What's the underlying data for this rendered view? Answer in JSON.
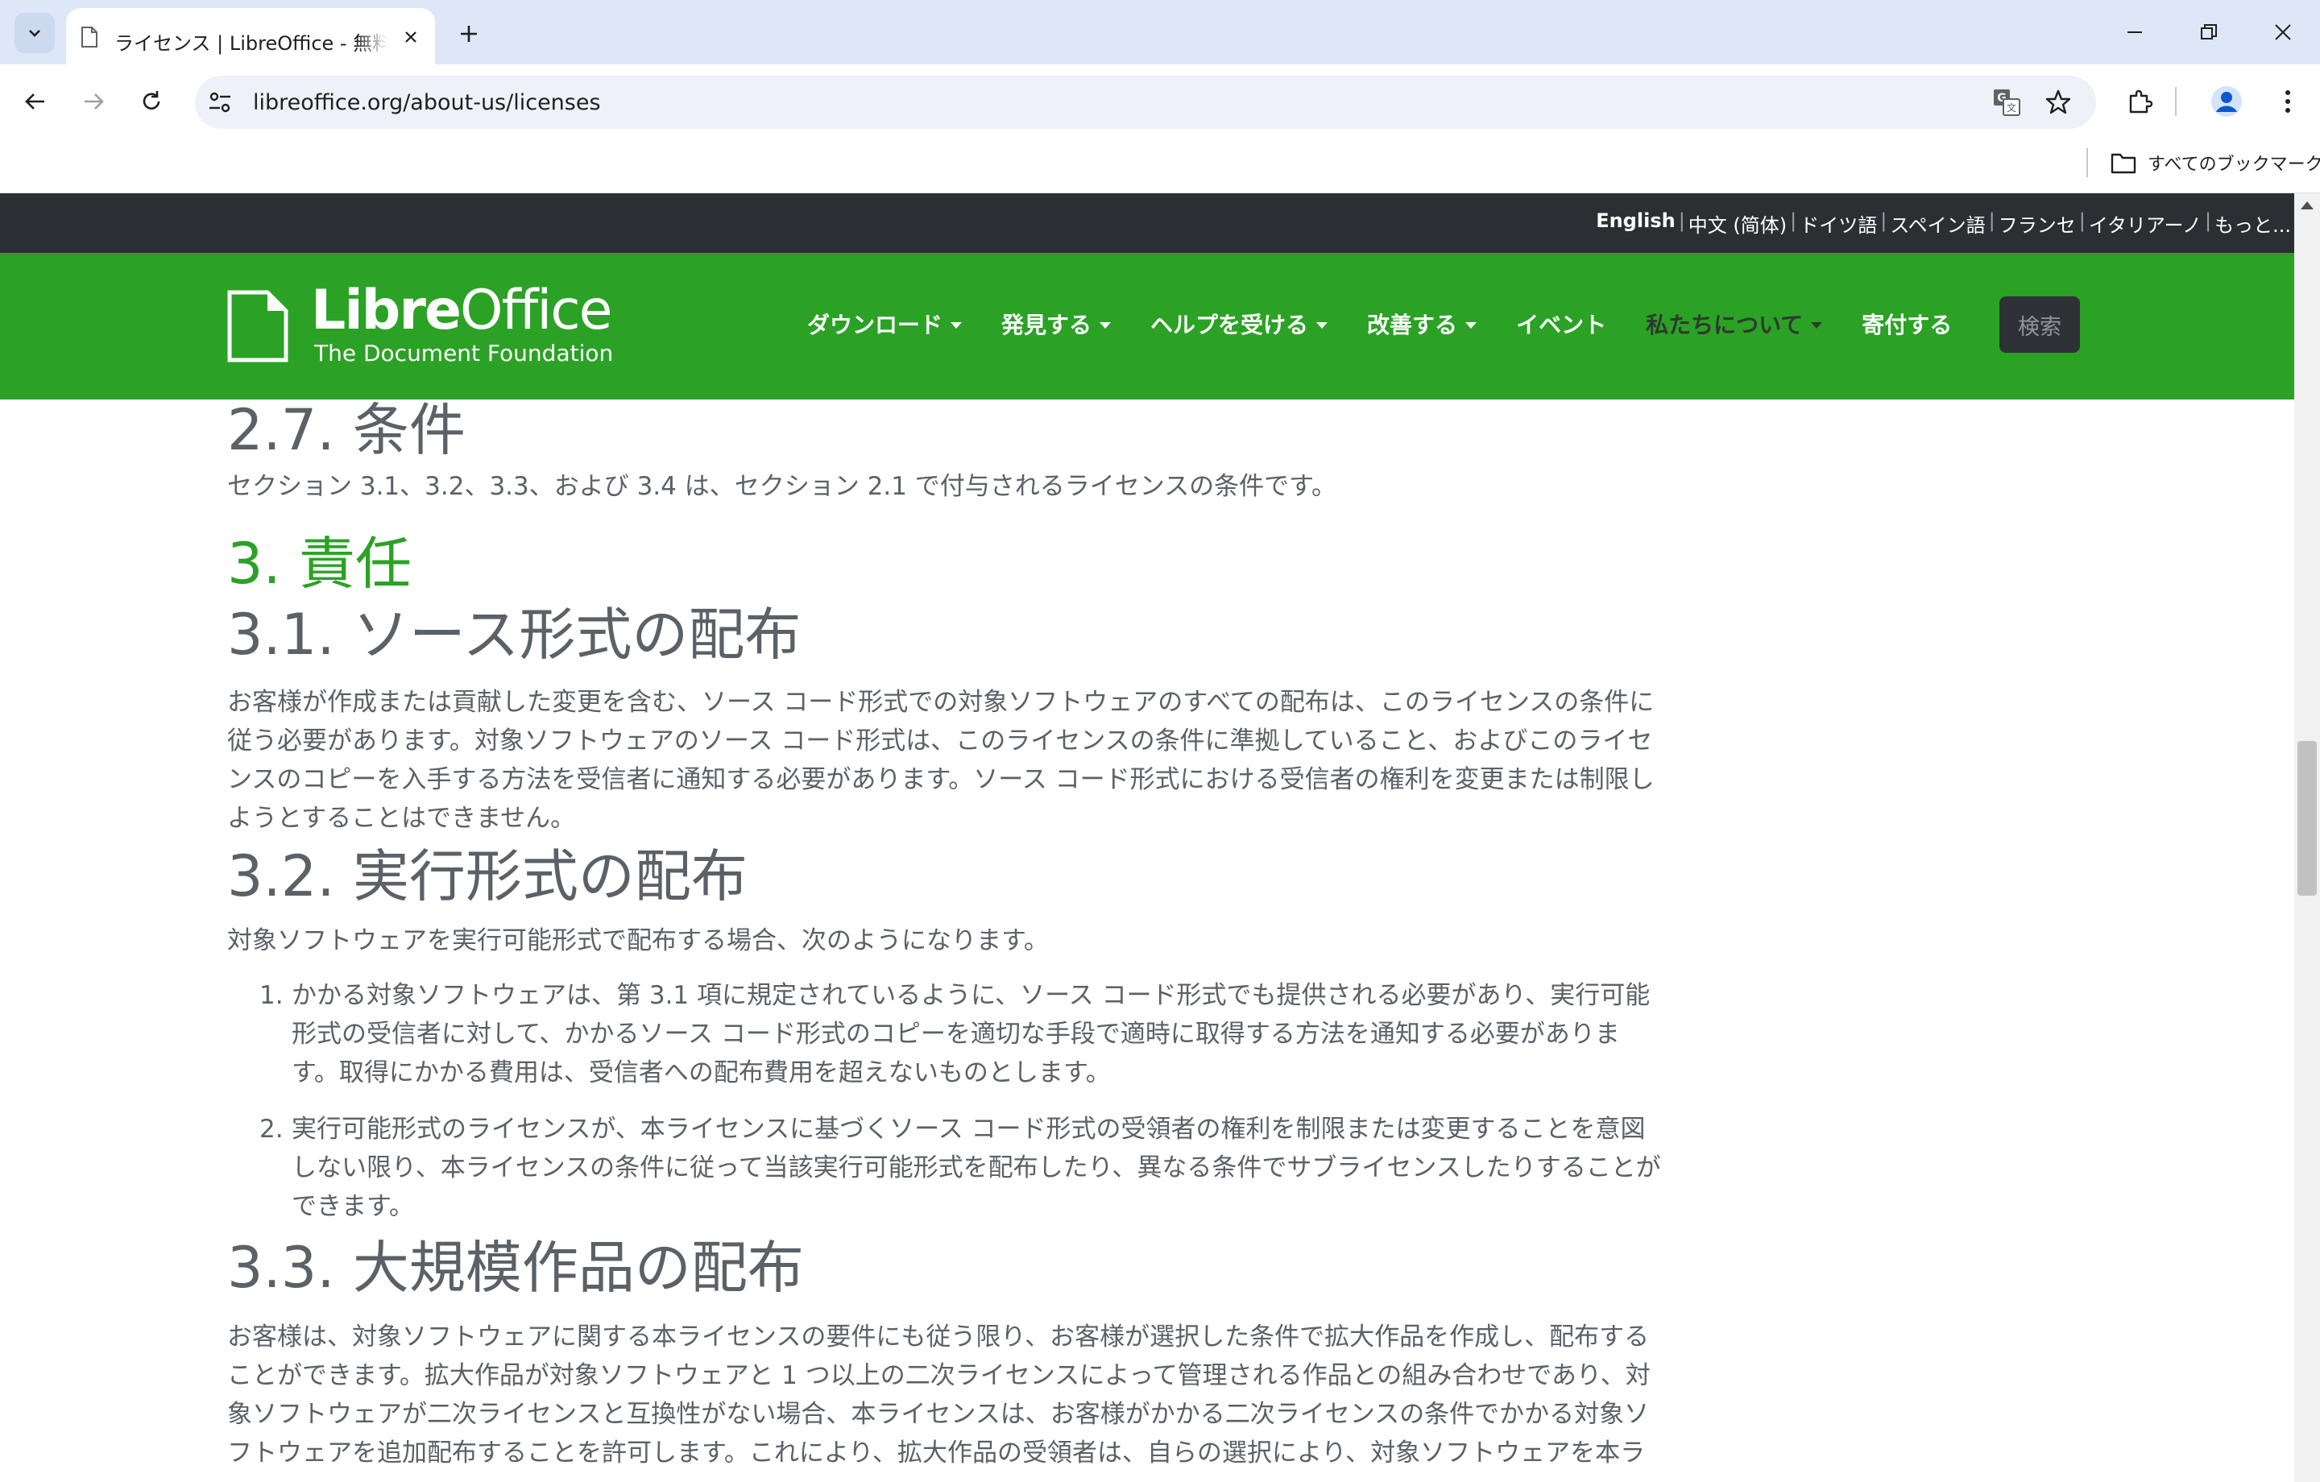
{
  "browser": {
    "tab_title": "ライセンス | LibreOffice - 無料のオフィススイート",
    "url": "libreoffice.org/about-us/licenses",
    "bookmarks_label": "すべてのブックマーク",
    "icons": [
      "tab-search-icon",
      "page-favicon-icon",
      "close-icon",
      "new-tab-icon",
      "minimize-icon",
      "restore-icon",
      "window-close-icon",
      "back-icon",
      "forward-icon",
      "reload-icon",
      "site-info-icon",
      "translate-icon",
      "star-icon",
      "extensions-icon",
      "profile-icon",
      "more-icon",
      "folder-icon"
    ]
  },
  "langbar": {
    "items": [
      "English",
      "中文 (简体)",
      "ドイツ語",
      "スペイン語",
      "フランセ",
      "イタリアーノ",
      "もっと..."
    ]
  },
  "site": {
    "logo_bold": "Libre",
    "logo_regular": "Office",
    "logo_tagline": "The Document Foundation",
    "menu": [
      "ダウンロード",
      "発見する",
      "ヘルプを受ける",
      "改善する",
      "イベント",
      "私たちについて",
      "寄付する"
    ],
    "search_label": "検索"
  },
  "content": {
    "h_27": "2.7. 条件",
    "p_27": "セクション 3.1、3.2、3.3、および 3.4 は、セクション 2.1 で付与されるライセンスの条件です。",
    "h_3": "3. 責任",
    "h_31": "3.1. ソース形式の配布",
    "p_31_l1": "お客様が作成または貢献した変更を含む、ソース コード形式での対象ソフトウェアのすべての配布は、このライセンスの条件に",
    "p_31_l2": "従う必要があります。対象ソフトウェアのソース コード形式は、このライセンスの条件に準拠していること、およびこのライセ",
    "p_31_l3": "ンスのコピーを入手する方法を受信者に通知する必要があります。ソース コード形式における受信者の権利を変更または制限し",
    "p_31_l4": "ようとすることはできません。",
    "h_32": "3.2. 実行形式の配布",
    "p_32": "対象ソフトウェアを実行可能形式で配布する場合、次のようになります。",
    "list_32": [
      {
        "num": "1.",
        "l1": "かかる対象ソフトウェアは、第 3.1 項に規定されているように、ソース コード形式でも提供される必要があり、実行可能",
        "l2": "形式の受信者に対して、かかるソース コード形式のコピーを適切な手段で適時に取得する方法を通知する必要がありま",
        "l3": "す。取得にかかる費用は、受信者への配布費用を超えないものとします。"
      },
      {
        "num": "2.",
        "l1": "実行可能形式のライセンスが、本ライセンスに基づくソース コード形式の受領者の権利を制限または変更することを意図",
        "l2": "しない限り、本ライセンスの条件に従って当該実行可能形式を配布したり、異なる条件でサブライセンスしたりすることが",
        "l3": "できます。"
      }
    ],
    "h_33": "3.3. 大規模作品の配布",
    "p_33_l1": "お客様は、対象ソフトウェアに関する本ライセンスの要件にも従う限り、お客様が選択した条件で拡大作品を作成し、配布する",
    "p_33_l2": "ことができます。拡大作品が対象ソフトウェアと 1 つ以上の二次ライセンスによって管理される作品との組み合わせであり、対",
    "p_33_l3": "象ソフトウェアが二次ライセンスと互換性がない場合、本ライセンスは、お客様がかかる二次ライセンスの条件でかかる対象ソ",
    "p_33_l4": "フトウェアを追加配布することを許可します。これにより、拡大作品の受領者は、自らの選択により、対象ソフトウェアを本ラ"
  },
  "colors": {
    "brand_green": "#2ba225",
    "langbar_bg": "#2b2e33",
    "text_gray": "#5b6166",
    "tabstrip_bg": "#dde7f8"
  }
}
